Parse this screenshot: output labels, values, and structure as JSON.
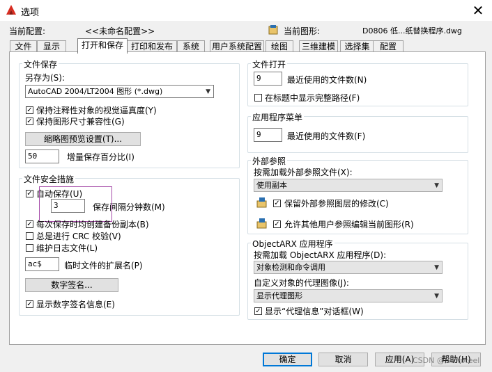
{
  "window": {
    "title": "选项"
  },
  "profile": {
    "current_profile_label": "当前配置:",
    "current_profile_value": "<<未命名配置>>",
    "current_drawing_label": "当前图形:",
    "current_drawing_value": "D0806 低...纸替换程序.dwg"
  },
  "tabs": [
    "文件",
    "显示",
    "打开和保存",
    "打印和发布",
    "系统",
    "用户系统配置",
    "绘图",
    "三维建模",
    "选择集",
    "配置"
  ],
  "file_save": {
    "title": "文件保存",
    "save_as_label": "另存为(S):",
    "save_as_value": "AutoCAD 2004/LT2004 图形 (*.dwg)",
    "maintain_visual_fidelity": "保持注释性对象的视觉逼真度(Y)",
    "maintain_drawing_size": "保持图形尺寸兼容性(G)",
    "thumbnail_button": "缩略图预览设置(T)...",
    "incremental_value": "50",
    "incremental_label": "增量保存百分比(I)"
  },
  "file_safety": {
    "title": "文件安全措施",
    "autosave_label": "自动保存(U)",
    "autosave_minutes_value": "3",
    "autosave_minutes_label": "保存间隔分钟数(M)",
    "backup_copy": "每次保存时均创建备份副本(B)",
    "crc_check": "总是进行 CRC 校验(V)",
    "log_file": "维护日志文件(L)",
    "temp_ext_value": "ac$",
    "temp_ext_label": "临时文件的扩展名(P)",
    "digital_sig_button": "数字签名...",
    "show_digital_sig": "显示数字签名信息(E)"
  },
  "file_open": {
    "title": "文件打开",
    "recent_value": "9",
    "recent_label": "最近使用的文件数(N)",
    "full_path": "在标题中显示完整路径(F)"
  },
  "app_menu": {
    "title": "应用程序菜单",
    "recent_value": "9",
    "recent_label": "最近使用的文件数(F)"
  },
  "xref": {
    "title": "外部参照",
    "demand_load_label": "按需加载外部参照文件(X):",
    "demand_load_value": "使用副本",
    "retain_changes": "保留外部参照图层的修改(C)",
    "allow_edit": "允许其他用户参照编辑当前图形(R)"
  },
  "objectarx": {
    "title": "ObjectARX 应用程序",
    "demand_load_label": "按需加载 ObjectARX 应用程序(D):",
    "demand_load_value": "对象检测和命令调用",
    "proxy_label": "自定义对象的代理图像(J):",
    "proxy_value": "显示代理图形",
    "show_proxy_dialog": "显示“代理信息”对话框(W)"
  },
  "footer": {
    "ok": "确定",
    "cancel": "取消",
    "apply": "应用(A)",
    "help": "帮助(H)",
    "watermark": "CSDN @Guiroteel"
  },
  "colors": {
    "accent": "#0078d7",
    "highlight": "#a54aa8",
    "logo": "#d82c20"
  }
}
